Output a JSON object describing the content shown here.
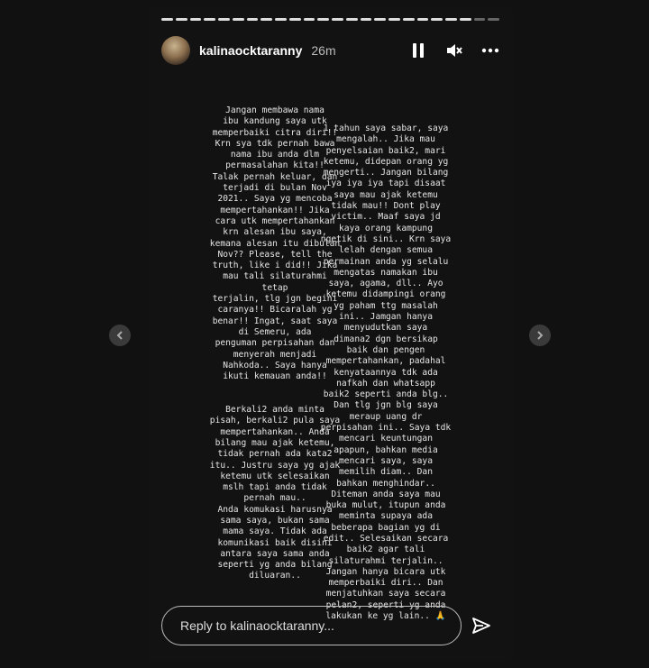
{
  "story": {
    "username": "kalinaocktaranny",
    "time": "26m",
    "column1": "Jangan membawa nama\nibu kandung saya utk\nmemperbaiki citra diri!!\nKrn sya tdk pernah bawa\nnama ibu anda dlm\npermasalahan kita!!\nTalak pernah keluar, dan\nterjadi di bulan Nov\n2021.. Saya yg mencoba\nmempertahankan!! Jika\ncara utk mempertahankan\nkrn alesan ibu saya,\nkemana alesan itu dibulan\nNov?? Please, tell the\ntruth, like i did!! Jika\nmau tali silaturahmi tetap\nterjalin, tlg jgn begini\ncaranya!! Bicaralah yg\nbenar!! Ingat, saat saya\ndi Semeru, ada\npenguman perpisahan dan\nmenyerah menjadi\nNahkoda.. Saya hanya\nikuti kemauan anda!!\n\n\nBerkali2 anda minta\npisah, berkali2 pula saya\nmempertahankan.. Anda\nbilang mau ajak ketemu,\ntidak pernah ada kata2\nitu.. Justru saya yg ajak\nketemu utk selesaikan\nmslh tapi anda tidak\npernah mau..\nAnda komukasi harusnya\nsama saya, bukan sama\nmama saya. Tidak ada\nkomunikasi baik disini\nantara saya sama anda\nseperti yg anda bilang\ndiluaran..",
    "column2": "1 tahun saya sabar, saya\nmengalah.. Jika mau\npenyelsaian baik2, mari\nketemu, didepan orang yg\nmengerti.. Jangan bilang\niya iya iya tapi disaat\nsaya mau ajak ketemu\ntidak mau!! Dont play\nvictim.. Maaf saya jd\nkaya orang kampung\nngetik di sini.. Krn saya\nlelah dengan semua\npermainan anda yg selalu\nmengatas namakan ibu\nsaya, agama, dll.. Ayo\nketemu didampingi orang\nyg paham ttg masalah\nini.. Jamgan hanya\nmenyudutkan saya\ndimana2 dgn bersikap\nbaik dan pengen\nmempertahankan, padahal\nkenyataannya tdk ada\nnafkah dan whatsapp\nbaik2 seperti anda blg..\nDan tlg jgn blg saya\nmeraup uang dr\nperpisahan ini.. Saya tdk\nmencari keuntungan\napapun, bahkan media\nmencari saya, saya\nmemilih diam.. Dan\nbahkan menghindar..\nDiteman anda saya mau\nbuka mulut, itupun anda\nmeminta supaya ada\nbeberapa bagian yg di\nedit.. Selesaikan secara\nbaik2 agar tali\nsilaturahmi terjalin..\nJangan hanya bicara utk\nmemperbaiki diri.. Dan\nmenjatuhkan saya secara\npelan2, seperti yg anda\nlakukan ke yg lain.. 🙏"
  },
  "reply": {
    "placeholder": "Reply to kalinaocktaranny..."
  },
  "icons": {
    "pause": "pause-icon",
    "mute": "speaker-muted-icon",
    "more": "more-horizontal-icon",
    "send": "paper-plane-icon",
    "prev": "chevron-left-icon",
    "next": "chevron-right-icon"
  },
  "progress": {
    "segments_total": 24,
    "segments_viewed": 22
  }
}
